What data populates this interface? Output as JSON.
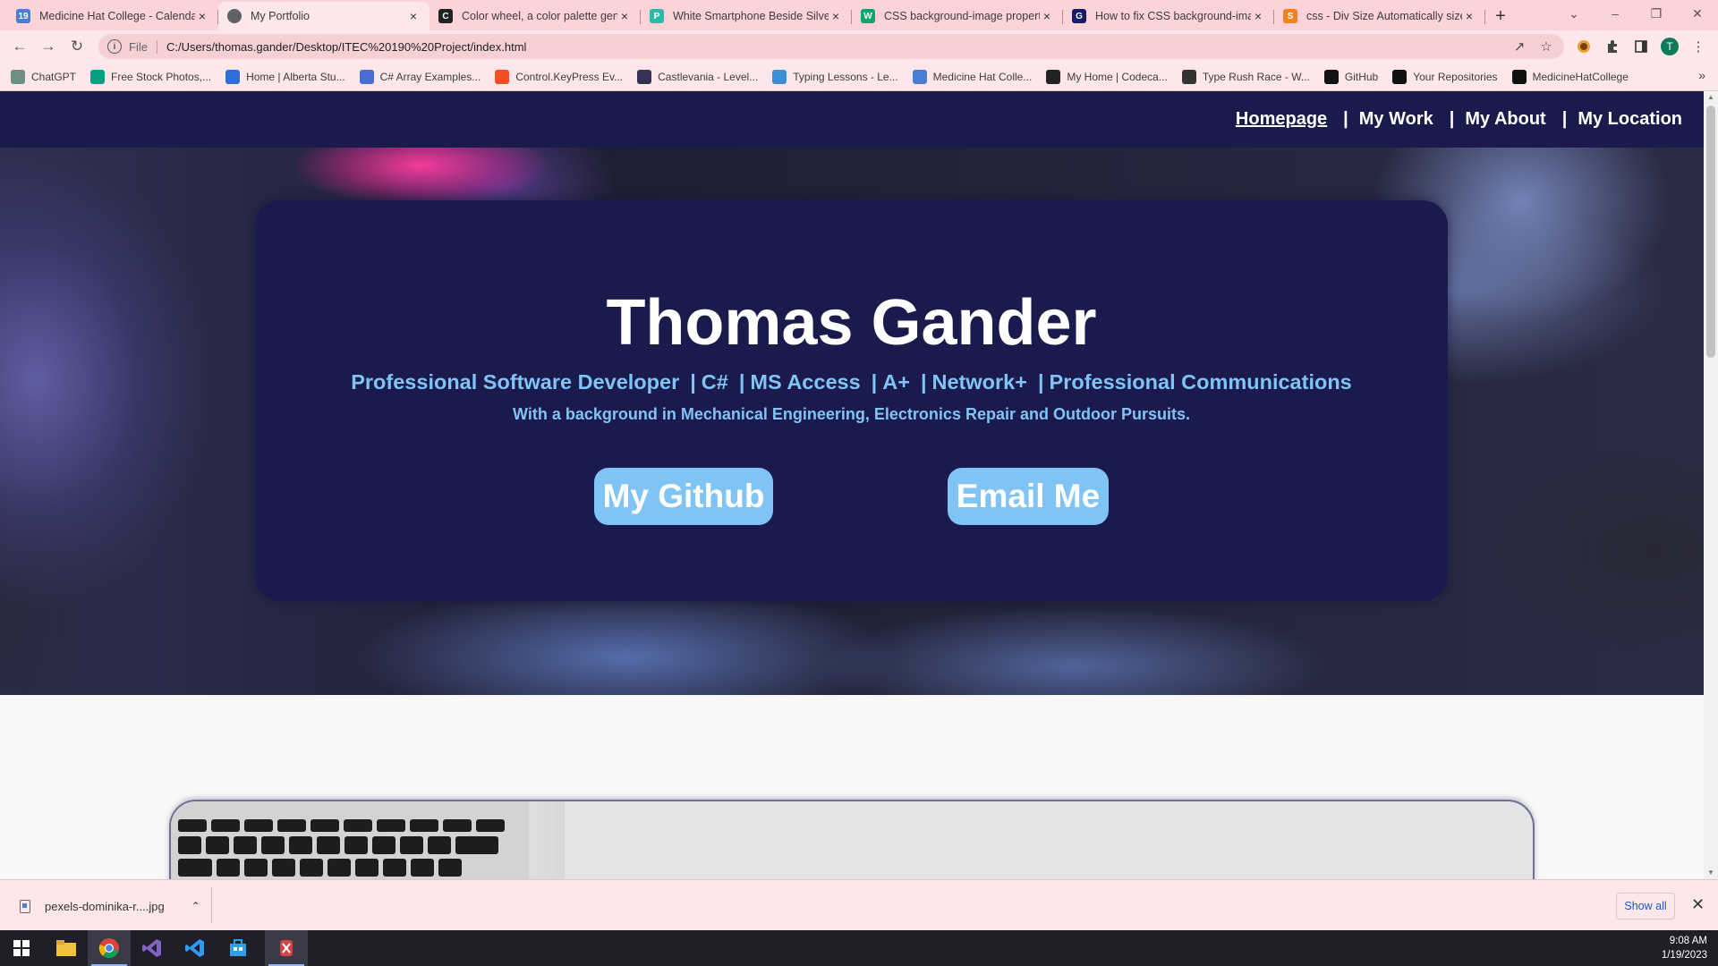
{
  "browser": {
    "tabs": [
      {
        "title": "Medicine Hat College - Calendar",
        "icon_color": "#4a7cd8",
        "icon_text": "19",
        "active": false
      },
      {
        "title": "My Portfolio",
        "icon_color": "#5f6368",
        "icon_text": "",
        "active": true
      },
      {
        "title": "Color wheel, a color palette generator",
        "icon_color": "#222222",
        "icon_text": "C",
        "active": false
      },
      {
        "title": "White Smartphone Beside Silver",
        "icon_color": "#2eb8a6",
        "icon_text": "P",
        "active": false
      },
      {
        "title": "CSS background-image property",
        "icon_color": "#04aa6d",
        "icon_text": "W",
        "active": false
      },
      {
        "title": "How to fix CSS background-image",
        "icon_color": "#1a1a6a",
        "icon_text": "G",
        "active": false
      },
      {
        "title": "css - Div Size Automatically size",
        "icon_color": "#f48024",
        "icon_text": "S",
        "active": false
      }
    ],
    "address": {
      "scheme_label": "File",
      "url": "C:/Users/thomas.gander/Desktop/ITEC%20190%20Project/index.html"
    },
    "profile_initial": "T",
    "bookmarks": [
      {
        "label": "ChatGPT",
        "color": "#6b8f82"
      },
      {
        "label": "Free Stock Photos,...",
        "color": "#05a081"
      },
      {
        "label": "Home | Alberta Stu...",
        "color": "#2e6fd8"
      },
      {
        "label": "C# Array Examples...",
        "color": "#4a6cd4"
      },
      {
        "label": "Control.KeyPress Ev...",
        "color": "#f25022"
      },
      {
        "label": "Castlevania - Level...",
        "color": "#333355"
      },
      {
        "label": "Typing Lessons - Le...",
        "color": "#3b8fd8"
      },
      {
        "label": "Medicine Hat Colle...",
        "color": "#4a7cd8"
      },
      {
        "label": "My Home | Codeca...",
        "color": "#222222"
      },
      {
        "label": "Type Rush Race - W...",
        "color": "#333333"
      },
      {
        "label": "GitHub",
        "color": "#111111"
      },
      {
        "label": "Your Repositories",
        "color": "#111111"
      },
      {
        "label": "MedicineHatCollege",
        "color": "#111111"
      }
    ]
  },
  "site": {
    "nav": [
      {
        "label": "Homepage",
        "current": true
      },
      {
        "label": "My Work",
        "current": false
      },
      {
        "label": "My About",
        "current": false
      },
      {
        "label": "My Location",
        "current": false
      }
    ],
    "nav_separator": "|",
    "hero": {
      "name": "Thomas Gander",
      "skills": [
        "Professional Software Developer",
        "C#",
        "MS Access",
        "A+",
        "Network+",
        "Professional Communications"
      ],
      "skills_separator": "|",
      "background_line": "With a background in Mechanical Engineering, Electronics Repair and Outdoor Pursuits.",
      "github_button": "My Github",
      "email_button": "Email Me"
    },
    "colors": {
      "nav_bg": "#1b1a4d",
      "card_bg": "#1b1a4d",
      "accent": "#7fc4f5"
    }
  },
  "downloads": {
    "file": "pexels-dominika-r....jpg",
    "show_all": "Show all"
  },
  "taskbar": {
    "time": "9:08 AM",
    "date": "1/19/2023"
  }
}
